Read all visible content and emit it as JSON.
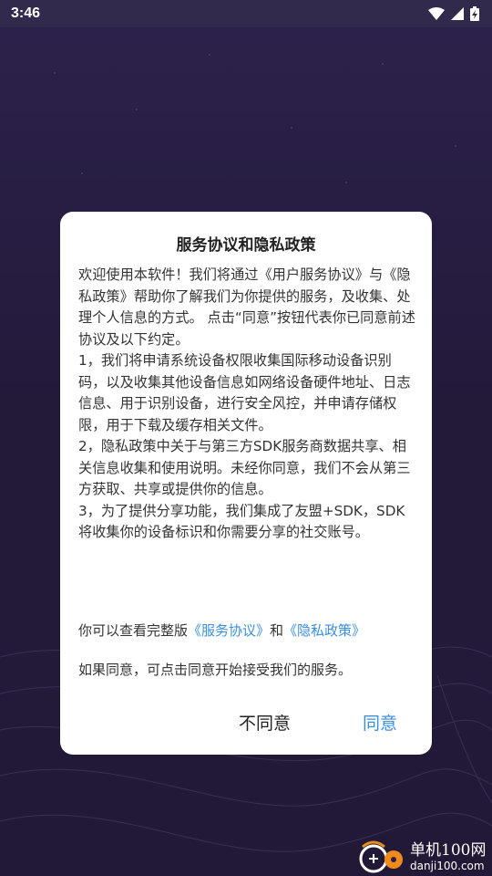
{
  "status_bar": {
    "time": "3:46"
  },
  "dialog": {
    "title": "服务协议和隐私政策",
    "paragraphs": [
      "欢迎使用本软件！我们将通过《用户服务协议》与《隐私政策》帮助你了解我们为你提供的服务，及收集、处理个人信息的方式。 点击“同意”按钮代表你已同意前述协议及以下约定。",
      " 1，我们将申请系统设备权限收集国际移动设备识别码，以及收集其他设备信息如网络设备硬件地址、日志信息、用于识别设备，进行安全风控，并申请存储权限，用于下载及缓存相关文件。",
      " 2，隐私政策中关于与第三方SDK服务商数据共享、相关信息收集和使用说明。未经你同意，我们不会从第三方获取、共享或提供你的信息。",
      " 3，为了提供分享功能，我们集成了友盟+SDK，SDK将收集你的设备标识和你需要分享的社交账号。"
    ],
    "links_prefix": "你可以查看完整版",
    "link_service": "《服务协议》",
    "links_and": "和",
    "link_privacy": "《隐私政策》",
    "consent_text": "如果同意，可点击同意开始接受我们的服务。",
    "disagree_label": "不同意",
    "agree_label": "同意"
  },
  "watermark": {
    "name": "单机100网",
    "url": "danji100.com"
  },
  "colors": {
    "link": "#3b8fe0",
    "background": "#2a1f45"
  }
}
